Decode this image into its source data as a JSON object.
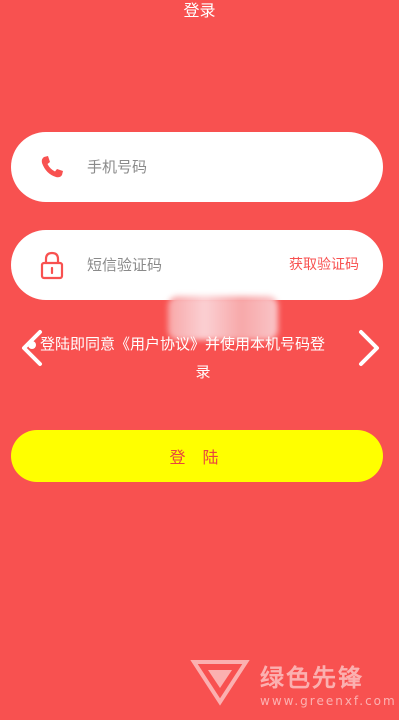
{
  "header": {
    "title": "登录"
  },
  "form": {
    "phone": {
      "placeholder": "手机号码",
      "icon": "phone-icon"
    },
    "code": {
      "placeholder": "短信验证码",
      "icon": "lock-icon",
      "get_code_label": "获取验证码"
    },
    "agreement": {
      "line1": "登陆即同意《用户协议》并使用本机号码登",
      "line2": "录"
    },
    "login_label": "登 陆"
  },
  "watermark": {
    "text": "绿色先锋",
    "url": "www.greenxf.com"
  },
  "colors": {
    "background": "#f85150",
    "button": "#ffff00",
    "accent": "#f85150"
  }
}
